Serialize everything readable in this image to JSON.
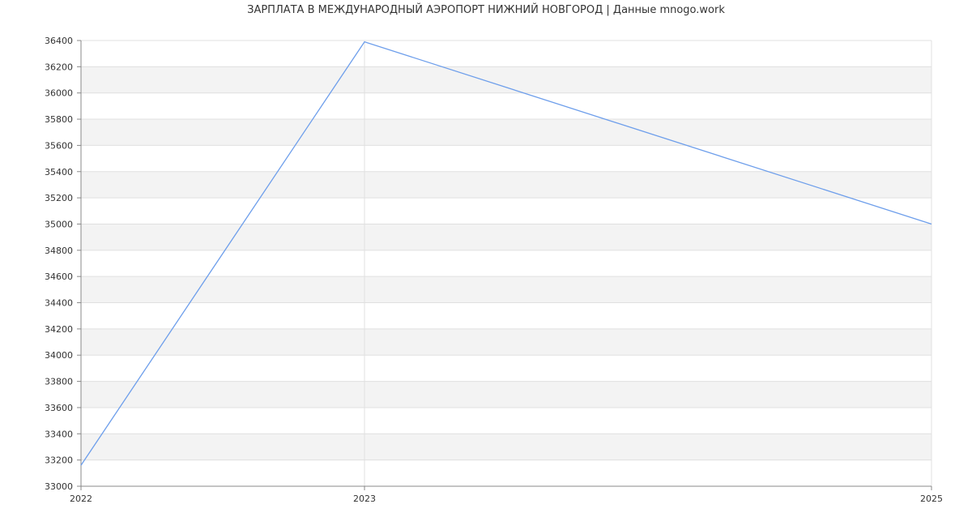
{
  "chart_data": {
    "type": "line",
    "title": "ЗАРПЛАТА В МЕЖДУНАРОДНЫЙ АЭРОПОРТ НИЖНИЙ НОВГОРОД | Данные mnogo.work",
    "xlabel": "",
    "ylabel": "",
    "x": [
      2022,
      2023,
      2025
    ],
    "series": [
      {
        "values": [
          33160,
          36390,
          35000
        ]
      }
    ],
    "ylim": [
      33000,
      36400
    ],
    "yticks": [
      33000,
      33200,
      33400,
      33600,
      33800,
      34000,
      34200,
      34400,
      34600,
      34800,
      35000,
      35200,
      35400,
      35600,
      35800,
      36000,
      36200,
      36400
    ],
    "xticks": [
      "2022",
      "2023",
      "2025"
    ],
    "grid": true,
    "legend": "none",
    "colors": {
      "line": "#6d9eeb",
      "band_alt": "#f3f3f3",
      "grid": "#e0e0e0",
      "axis": "#888888"
    }
  }
}
